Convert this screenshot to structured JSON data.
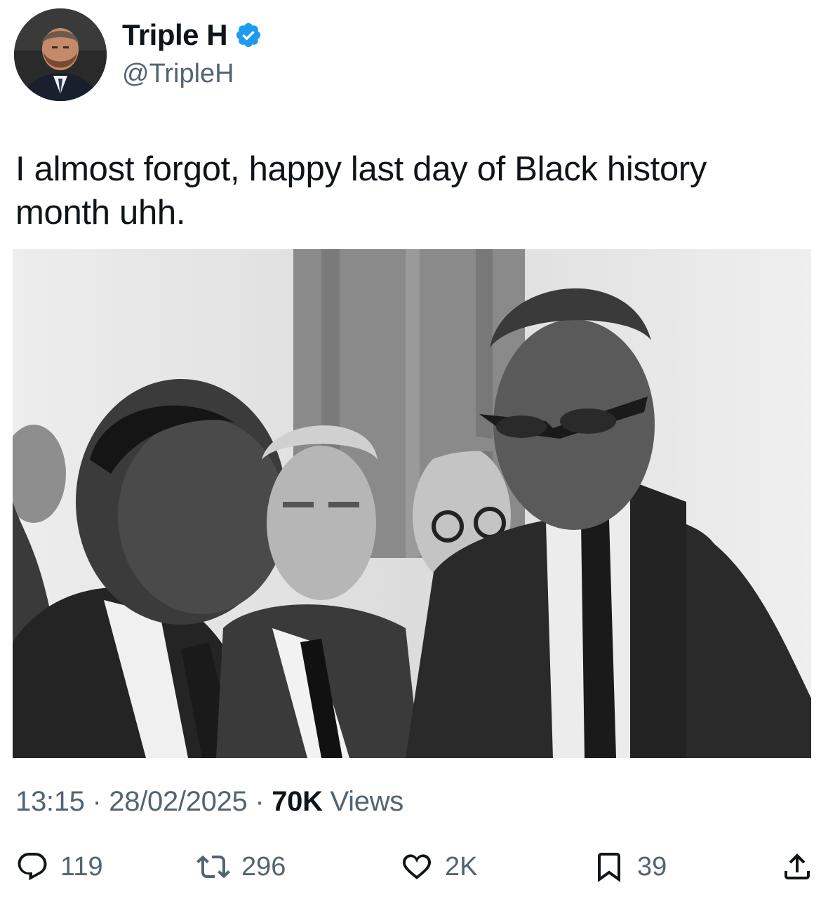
{
  "author": {
    "display_name": "Triple H",
    "handle": "@TripleH",
    "verified": true,
    "avatar_icon": "profile-photo"
  },
  "tweet": {
    "text": "I almost forgot, happy last day of Black history month uhh."
  },
  "media": {
    "type": "black-and-white photograph"
  },
  "meta": {
    "time": "13:15",
    "separator": "·",
    "date": "28/02/2025",
    "views_count": "70K",
    "views_label": "Views"
  },
  "actions": {
    "reply": {
      "icon": "reply-icon",
      "count": "119"
    },
    "retweet": {
      "icon": "retweet-icon",
      "count": "296"
    },
    "like": {
      "icon": "heart-icon",
      "count": "2K"
    },
    "bookmark": {
      "icon": "bookmark-icon",
      "count": "39"
    },
    "share": {
      "icon": "share-icon"
    }
  },
  "colors": {
    "verified_badge": "#1d9bf0",
    "text_primary": "#0f1419",
    "text_secondary": "#536471"
  }
}
